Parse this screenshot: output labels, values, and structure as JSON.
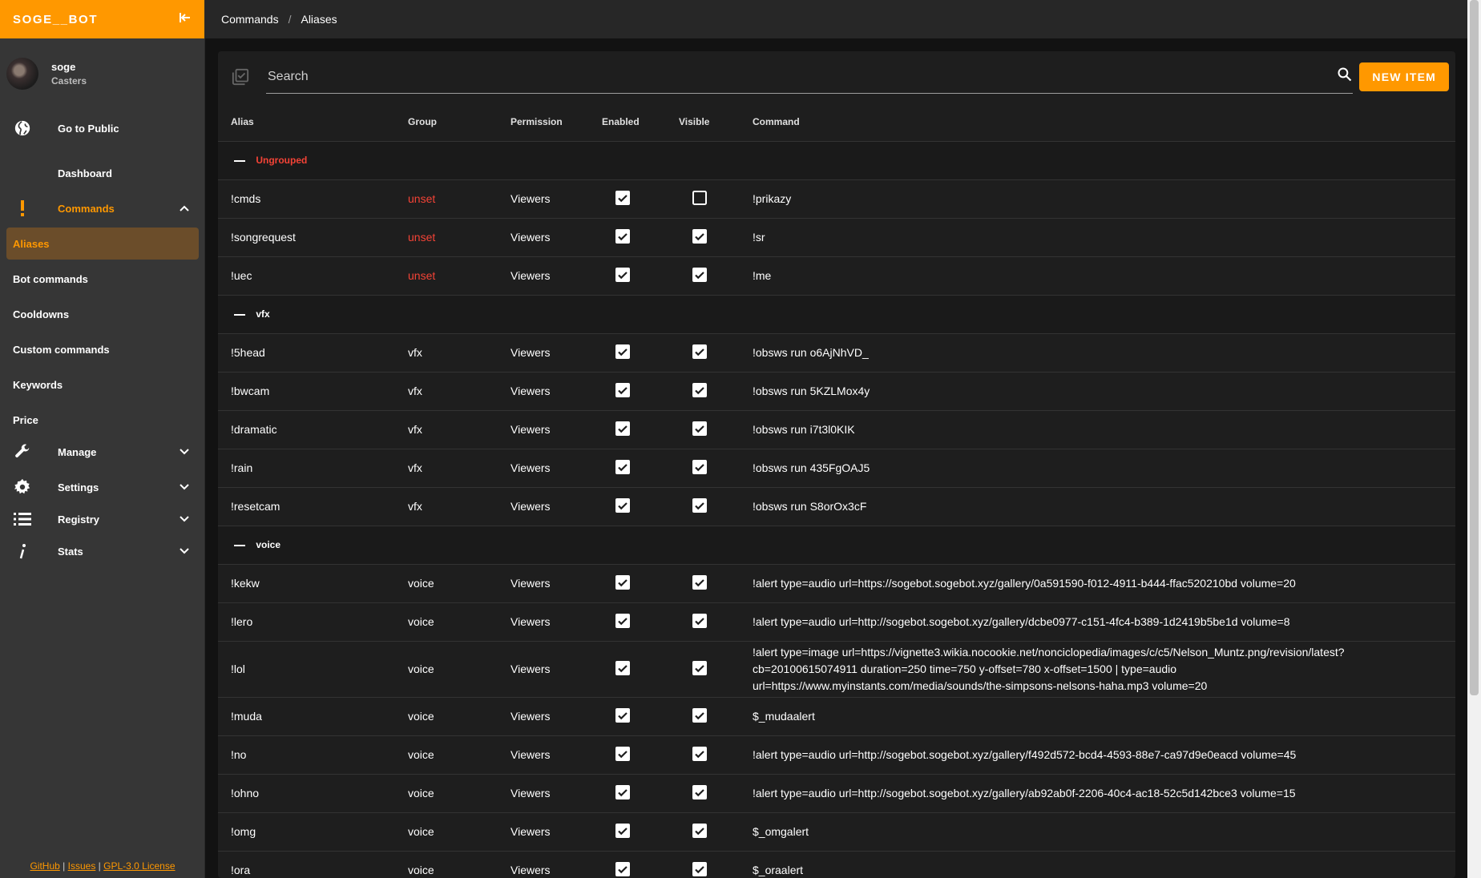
{
  "app": {
    "title": "SOGE__BOT"
  },
  "user": {
    "name": "soge",
    "role": "Casters"
  },
  "nav": {
    "go_to_public": "Go to Public",
    "dashboard": "Dashboard",
    "commands": "Commands",
    "commands_children": [
      "Aliases",
      "Bot commands",
      "Cooldowns",
      "Custom commands",
      "Keywords",
      "Price"
    ],
    "manage": "Manage",
    "settings": "Settings",
    "registry": "Registry",
    "stats": "Stats"
  },
  "footer": {
    "github": "GitHub",
    "issues": "Issues",
    "license": "GPL-3.0 License",
    "separator": "|"
  },
  "breadcrumb": {
    "parent": "Commands",
    "separator": "/",
    "current": "Aliases"
  },
  "search": {
    "placeholder": "Search"
  },
  "new_item_label": "NEW ITEM",
  "table": {
    "headers": {
      "alias": "Alias",
      "group": "Group",
      "permission": "Permission",
      "enabled": "Enabled",
      "visible": "Visible",
      "command": "Command"
    },
    "groups": [
      {
        "name": "Ungrouped",
        "rows": [
          {
            "alias": "!cmds",
            "group": "unset",
            "permission": "Viewers",
            "enabled": true,
            "visible": false,
            "command": "!prikazy"
          },
          {
            "alias": "!songrequest",
            "group": "unset",
            "permission": "Viewers",
            "enabled": true,
            "visible": true,
            "command": "!sr"
          },
          {
            "alias": "!uec",
            "group": "unset",
            "permission": "Viewers",
            "enabled": true,
            "visible": true,
            "command": "!me"
          }
        ]
      },
      {
        "name": "vfx",
        "rows": [
          {
            "alias": "!5head",
            "group": "vfx",
            "permission": "Viewers",
            "enabled": true,
            "visible": true,
            "command": "!obsws run o6AjNhVD_"
          },
          {
            "alias": "!bwcam",
            "group": "vfx",
            "permission": "Viewers",
            "enabled": true,
            "visible": true,
            "command": "!obsws run 5KZLMox4y"
          },
          {
            "alias": "!dramatic",
            "group": "vfx",
            "permission": "Viewers",
            "enabled": true,
            "visible": true,
            "command": "!obsws run i7t3l0KIK"
          },
          {
            "alias": "!rain",
            "group": "vfx",
            "permission": "Viewers",
            "enabled": true,
            "visible": true,
            "command": "!obsws run 435FgOAJ5"
          },
          {
            "alias": "!resetcam",
            "group": "vfx",
            "permission": "Viewers",
            "enabled": true,
            "visible": true,
            "command": "!obsws run S8orOx3cF"
          }
        ]
      },
      {
        "name": "voice",
        "rows": [
          {
            "alias": "!kekw",
            "group": "voice",
            "permission": "Viewers",
            "enabled": true,
            "visible": true,
            "command": "!alert type=audio url=https://sogebot.sogebot.xyz/gallery/0a591590-f012-4911-b444-ffac520210bd volume=20"
          },
          {
            "alias": "!lero",
            "group": "voice",
            "permission": "Viewers",
            "enabled": true,
            "visible": true,
            "command": "!alert type=audio url=http://sogebot.sogebot.xyz/gallery/dcbe0977-c151-4fc4-b389-1d2419b5be1d volume=8"
          },
          {
            "alias": "!lol",
            "group": "voice",
            "permission": "Viewers",
            "enabled": true,
            "visible": true,
            "command": "!alert type=image url=https://vignette3.wikia.nocookie.net/nonciclopedia/images/c/c5/Nelson_Muntz.png/revision/latest?cb=20100615074911 duration=250 time=750 y-offset=780 x-offset=1500 | type=audio url=https://www.myinstants.com/media/sounds/the-simpsons-nelsons-haha.mp3 volume=20"
          },
          {
            "alias": "!muda",
            "group": "voice",
            "permission": "Viewers",
            "enabled": true,
            "visible": true,
            "command": "$_mudaalert"
          },
          {
            "alias": "!no",
            "group": "voice",
            "permission": "Viewers",
            "enabled": true,
            "visible": true,
            "command": "!alert type=audio url=http://sogebot.sogebot.xyz/gallery/f492d572-bcd4-4593-88e7-ca97d9e0eacd volume=45"
          },
          {
            "alias": "!ohno",
            "group": "voice",
            "permission": "Viewers",
            "enabled": true,
            "visible": true,
            "command": "!alert type=audio url=http://sogebot.sogebot.xyz/gallery/ab92ab0f-2206-40c4-ac18-52c5d142bce3 volume=15"
          },
          {
            "alias": "!omg",
            "group": "voice",
            "permission": "Viewers",
            "enabled": true,
            "visible": true,
            "command": "$_omgalert"
          },
          {
            "alias": "!ora",
            "group": "voice",
            "permission": "Viewers",
            "enabled": true,
            "visible": true,
            "command": "$_oraalert"
          }
        ]
      }
    ]
  },
  "colors": {
    "accent": "#ff9800",
    "unset": "#f44336",
    "sidebar_bg": "#363636",
    "card_bg": "#1e1e1e"
  },
  "icons": {
    "collapse": "collapse-left-icon",
    "public": "globe-icon",
    "commands": "exclamation-icon",
    "manage": "wrench-icon",
    "settings": "gear-icon",
    "registry": "list-icon",
    "stats": "info-icon",
    "search": "search-icon",
    "select_all": "select-all-icon"
  }
}
